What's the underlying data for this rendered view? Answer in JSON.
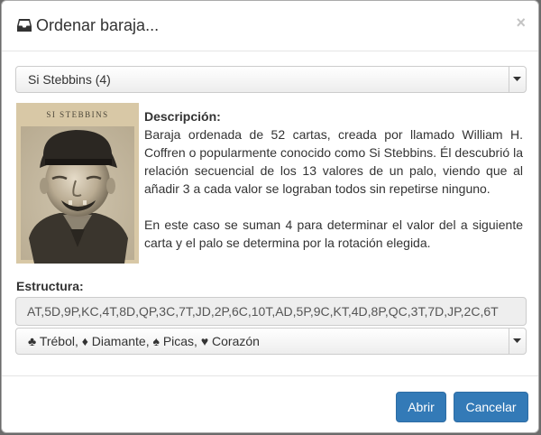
{
  "dialog": {
    "title": "Ordenar baraja...",
    "close_glyph": "×",
    "icon": "inbox-tray-icon"
  },
  "deck_select": {
    "selected": "Si Stebbins (4)"
  },
  "portrait": {
    "caption": "SI STEBBINS"
  },
  "description": {
    "label": "Descripción:",
    "paragraph1": "Baraja ordenada de 52 cartas, creada por llamado William H. Coffren o popularmente conocido como Si Stebbins. Él descubrió la relación secuencial de los 13 valores de un palo, viendo que al añadir 3 a cada valor se lograban todos sin repetirse ninguno.",
    "paragraph2": "En este caso se suman 4 para determinar el valor del a siguiente carta y el palo se determina por la rotación elegida."
  },
  "structure": {
    "label": "Estructura:",
    "value": "AT,5D,9P,KC,4T,8D,QP,3C,7T,JD,2P,6C,10T,AD,5P,9C,KT,4D,8P,QC,3T,7D,JP,2C,6T"
  },
  "suit_select": {
    "selected": "♣ Trébol, ♦ Diamante, ♠ Picas, ♥ Corazón"
  },
  "footer": {
    "open_label": "Abrir",
    "cancel_label": "Cancelar"
  },
  "colors": {
    "primary": "#337ab7",
    "primary_border": "#2e6da4",
    "sepia": "#d8c8a6"
  }
}
